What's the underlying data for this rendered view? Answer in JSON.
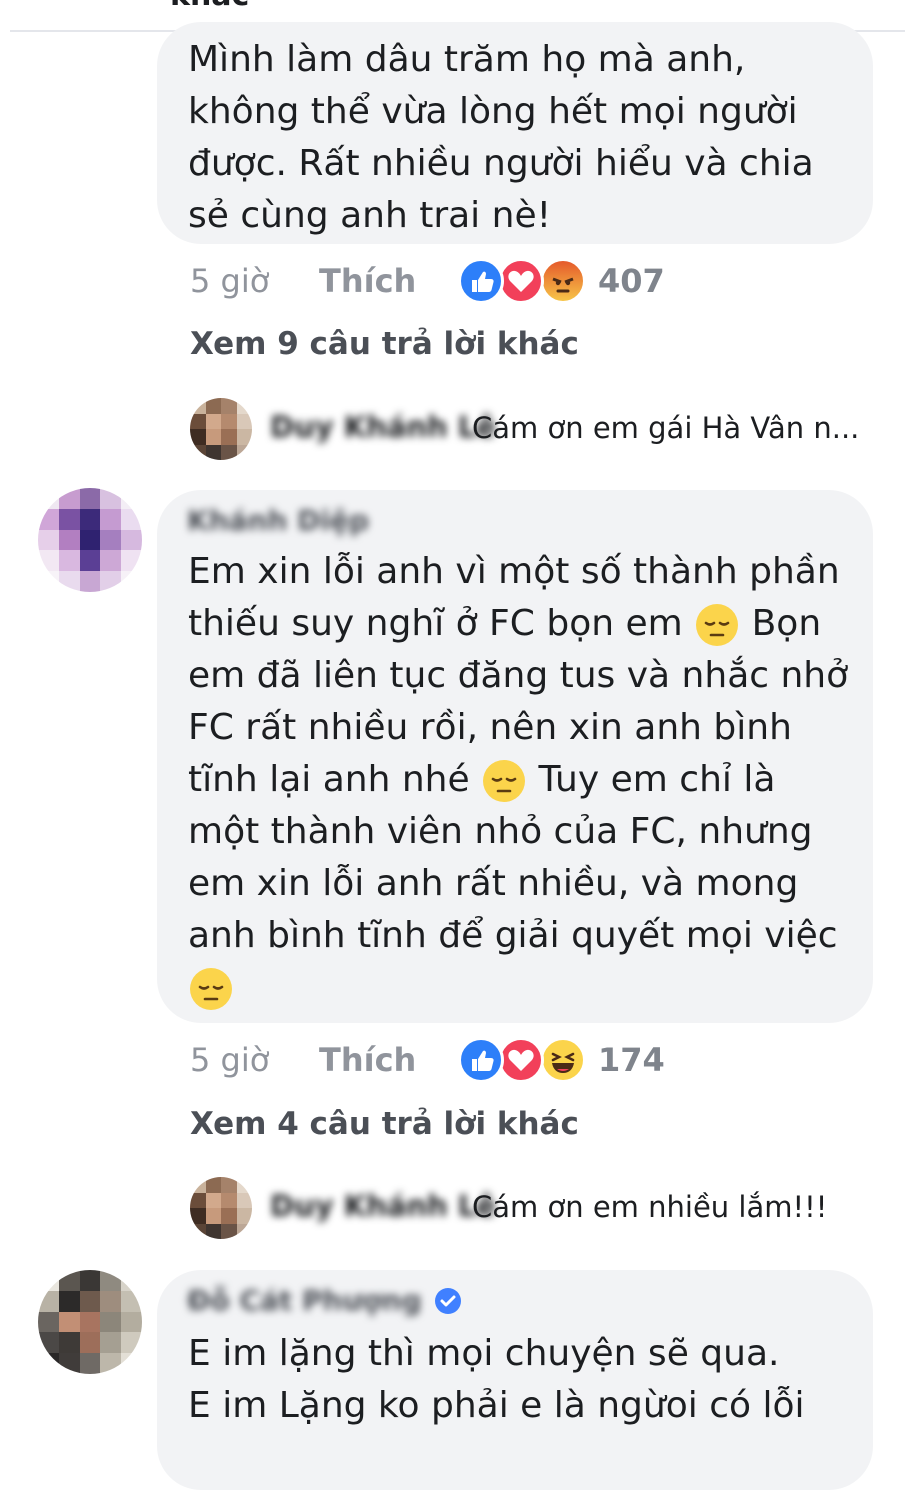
{
  "header_fragment": "khác",
  "comments": [
    {
      "author": "",
      "text": "Mình làm dâu trăm họ mà anh, không thể vừa lòng hết mọi người được. Rất nhiều người hiểu và chia sẻ cùng anh trai nè!",
      "lines": [
        "Mình làm dâu trăm họ mà anh,",
        "không thể vừa lòng hết mọi người",
        "được. Rất nhiều người hiểu và chia",
        "sẻ cùng anh trai nè!"
      ],
      "time": "5 giờ",
      "like_label": "Thích",
      "reactions": [
        "like-icon",
        "love-icon",
        "angry-icon"
      ],
      "reaction_count": "407",
      "more_replies": "Xem 9 câu trả lời khác",
      "reply": {
        "author": "Duy Khánh Lê",
        "text": "Cám ơn em gái Hà Vân n..."
      }
    },
    {
      "author": "Khánh Diệp",
      "lines": [
        "Em xin lỗi anh vì một số thành phần",
        "thiếu suy nghĩ ở FC bọn em {sad} Bọn",
        "em đã liên tục đăng tus và nhắc nhở",
        "FC rất nhiều rồi, nên xin anh bình",
        "tĩnh lại anh nhé {sad} Tuy em chỉ là",
        "một thành viên nhỏ của FC, nhưng",
        "em xin lỗi anh rất nhiều, và mong",
        "anh bình tĩnh để giải quyết mọi việc",
        "{sad}"
      ],
      "line_parts": {
        "l1a": "Em xin lỗi anh vì một số thành phần",
        "l2a": "thiếu suy nghĩ ở FC bọn em",
        "l2b": "Bọn",
        "l3a": "em đã liên tục đăng tus và nhắc nhở",
        "l4a": "FC rất nhiều rồi, nên xin anh bình",
        "l5a": "tĩnh lại anh nhé",
        "l5b": "Tuy em chỉ là",
        "l6a": "một thành viên nhỏ của FC, nhưng",
        "l7a": "em xin lỗi anh rất nhiều, và mong",
        "l8a": "anh bình tĩnh để giải quyết mọi việc"
      },
      "time": "5 giờ",
      "like_label": "Thích",
      "reactions": [
        "like-icon",
        "love-icon",
        "haha-icon"
      ],
      "reaction_count": "174",
      "more_replies": "Xem 4 câu trả lời khác",
      "reply": {
        "author": "Duy Khánh Lê",
        "text": "Cám ơn em nhiều lắm!!!"
      }
    },
    {
      "author": "Đỗ Cát Phượng",
      "verified": true,
      "lines": [
        "E im lặng thì mọi chuyện sẽ qua.",
        "E im Lặng ko phải e là ngừoi có lỗi"
      ]
    }
  ]
}
